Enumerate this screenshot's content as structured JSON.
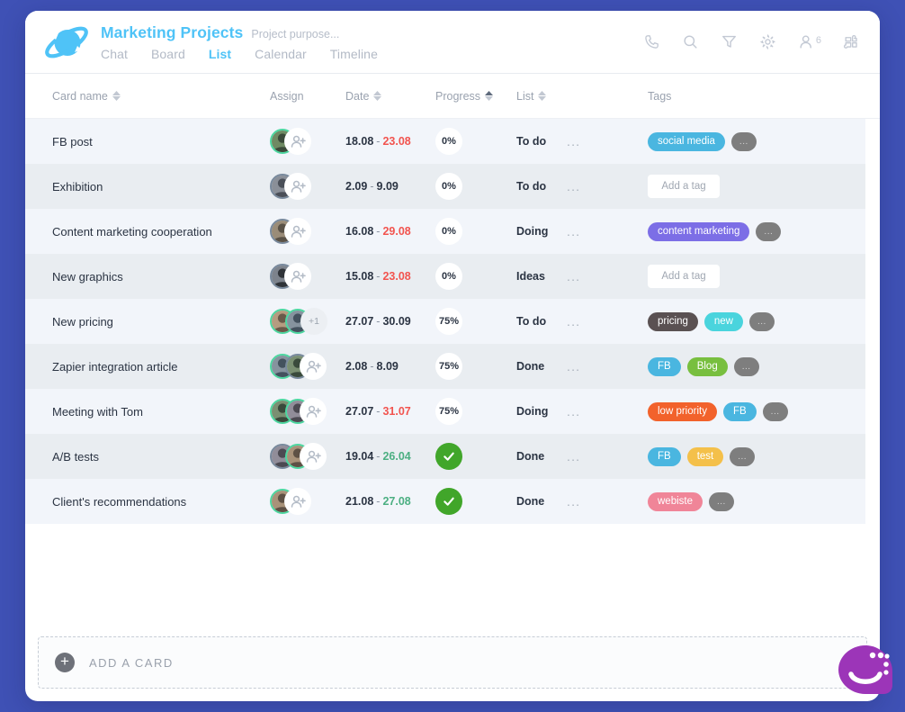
{
  "header": {
    "logo_icon": "planet-logo-icon",
    "title": "Marketing Projects",
    "purpose": "Project purpose...",
    "nav": [
      {
        "label": "Chat",
        "active": false
      },
      {
        "label": "Board",
        "active": false
      },
      {
        "label": "List",
        "active": true
      },
      {
        "label": "Calendar",
        "active": false
      },
      {
        "label": "Timeline",
        "active": false
      }
    ],
    "icons": [
      {
        "name": "phone-icon"
      },
      {
        "name": "search-icon"
      },
      {
        "name": "filter-icon"
      },
      {
        "name": "gear-icon"
      },
      {
        "name": "members-icon",
        "badge": "6"
      },
      {
        "name": "apps-icon"
      }
    ],
    "accent_color": "#4fc3f7",
    "page_background": "#3f51b5"
  },
  "table": {
    "columns": [
      {
        "label": "Card name",
        "sortable": true,
        "sort_state": "none"
      },
      {
        "label": "Assign",
        "sortable": false,
        "sort_state": "none"
      },
      {
        "label": "Date",
        "sortable": true,
        "sort_state": "none"
      },
      {
        "label": "Progress",
        "sortable": true,
        "sort_state": "asc"
      },
      {
        "label": "List",
        "sortable": true,
        "sort_state": "none"
      },
      {
        "label": "Tags",
        "sortable": false,
        "sort_state": "none"
      }
    ],
    "rows": [
      {
        "name": "FB post",
        "avatars": [
          {
            "ring": "green"
          }
        ],
        "extra": null,
        "date_start": "18.08",
        "date_end": "23.08",
        "date_end_state": "red",
        "progress": "0%",
        "progress_done": false,
        "list": "To do",
        "tags": [
          {
            "label": "social media",
            "color": "#4ab6e0"
          }
        ],
        "more_tag": "...",
        "add_tag": null
      },
      {
        "name": "Exhibition",
        "avatars": [
          {
            "ring": "slate"
          }
        ],
        "extra": null,
        "date_start": "2.09",
        "date_end": "9.09",
        "date_end_state": "dark",
        "progress": "0%",
        "progress_done": false,
        "list": "To do",
        "tags": [],
        "more_tag": null,
        "add_tag": "Add a tag"
      },
      {
        "name": "Content marketing cooperation",
        "avatars": [
          {
            "ring": "slate"
          }
        ],
        "extra": null,
        "date_start": "16.08",
        "date_end": "29.08",
        "date_end_state": "red",
        "progress": "0%",
        "progress_done": false,
        "list": "Doing",
        "tags": [
          {
            "label": "content marketing",
            "color": "#7c6ee6"
          }
        ],
        "more_tag": "...",
        "add_tag": null
      },
      {
        "name": "New graphics",
        "avatars": [
          {
            "ring": "slate"
          }
        ],
        "extra": null,
        "date_start": "15.08",
        "date_end": "23.08",
        "date_end_state": "red",
        "progress": "0%",
        "progress_done": false,
        "list": "Ideas",
        "tags": [],
        "more_tag": null,
        "add_tag": "Add a tag"
      },
      {
        "name": "New pricing",
        "avatars": [
          {
            "ring": "green"
          },
          {
            "ring": "green"
          }
        ],
        "extra": "+1",
        "date_start": "27.07",
        "date_end": "30.09",
        "date_end_state": "dark",
        "progress": "75%",
        "progress_done": false,
        "list": "To do",
        "tags": [
          {
            "label": "pricing",
            "color": "#5a5152"
          },
          {
            "label": "new",
            "color": "#4ad4dd"
          }
        ],
        "more_tag": "...",
        "add_tag": null
      },
      {
        "name": "Zapier integration article",
        "avatars": [
          {
            "ring": "green"
          },
          {
            "ring": "slate"
          }
        ],
        "extra": null,
        "date_start": "2.08",
        "date_end": "8.09",
        "date_end_state": "dark",
        "progress": "75%",
        "progress_done": false,
        "list": "Done",
        "tags": [
          {
            "label": "FB",
            "color": "#4ab6e0"
          },
          {
            "label": "Blog",
            "color": "#78bf3f"
          }
        ],
        "more_tag": "...",
        "add_tag": null
      },
      {
        "name": "Meeting with Tom",
        "avatars": [
          {
            "ring": "green"
          },
          {
            "ring": "green"
          }
        ],
        "extra": null,
        "date_start": "27.07",
        "date_end": "31.07",
        "date_end_state": "red",
        "progress": "75%",
        "progress_done": false,
        "list": "Doing",
        "tags": [
          {
            "label": "low priority",
            "color": "#f2622b"
          },
          {
            "label": "FB",
            "color": "#4ab6e0"
          }
        ],
        "more_tag": "...",
        "add_tag": null
      },
      {
        "name": "A/B tests",
        "avatars": [
          {
            "ring": "slate"
          },
          {
            "ring": "green"
          }
        ],
        "extra": null,
        "date_start": "19.04",
        "date_end": "26.04",
        "date_end_state": "green",
        "progress": "",
        "progress_done": true,
        "list": "Done",
        "tags": [
          {
            "label": "FB",
            "color": "#4ab6e0"
          },
          {
            "label": "test",
            "color": "#f4c04a"
          }
        ],
        "more_tag": "...",
        "add_tag": null
      },
      {
        "name": "Client's recommendations",
        "avatars": [
          {
            "ring": "green"
          }
        ],
        "extra": null,
        "date_start": "21.08",
        "date_end": "27.08",
        "date_end_state": "green",
        "progress": "",
        "progress_done": true,
        "list": "Done",
        "tags": [
          {
            "label": "webiste",
            "color": "#f08598"
          }
        ],
        "more_tag": "...",
        "add_tag": null
      }
    ],
    "row_menu_glyph": "..."
  },
  "add_card": {
    "icon": "plus-circle-icon",
    "label": "ADD A CARD"
  },
  "chat_widget": {
    "icon": "chat-smiley-icon",
    "color": "#9c35b8"
  }
}
